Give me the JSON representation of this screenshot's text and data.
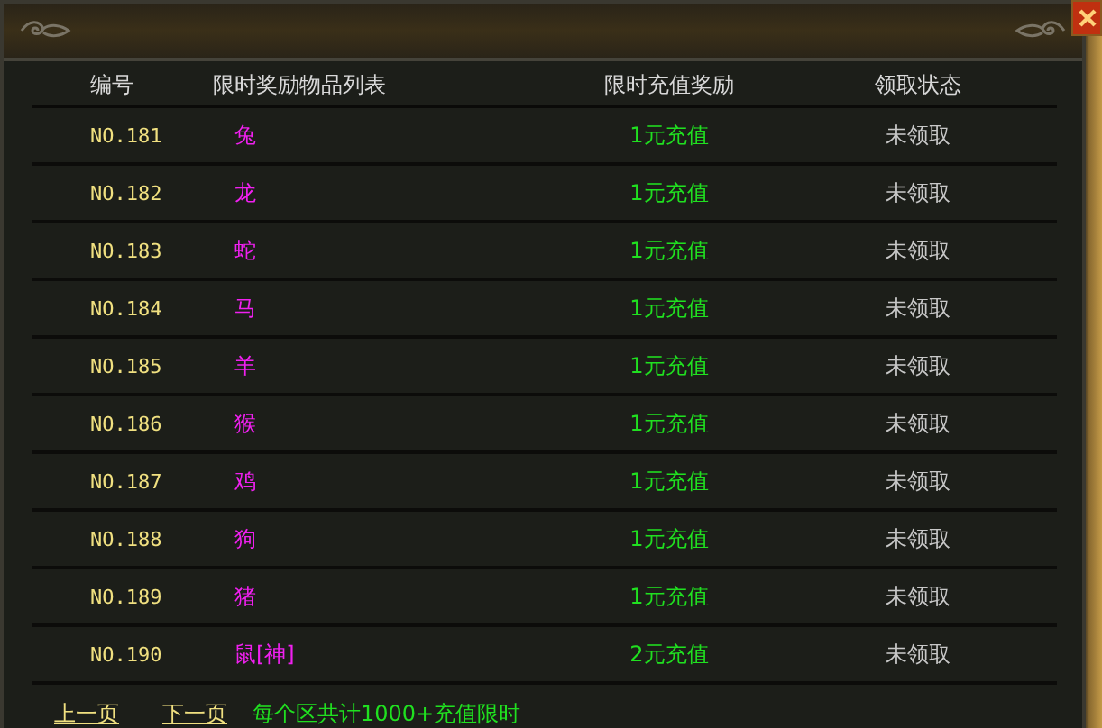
{
  "columns": [
    "编号",
    "限时奖励物品列表",
    "限时充值奖励",
    "领取状态"
  ],
  "rows": [
    {
      "number": "NO.181",
      "item": "兔",
      "reward": "1元充值",
      "status": "未领取"
    },
    {
      "number": "NO.182",
      "item": "龙",
      "reward": "1元充值",
      "status": "未领取"
    },
    {
      "number": "NO.183",
      "item": "蛇",
      "reward": "1元充值",
      "status": "未领取"
    },
    {
      "number": "NO.184",
      "item": "马",
      "reward": "1元充值",
      "status": "未领取"
    },
    {
      "number": "NO.185",
      "item": "羊",
      "reward": "1元充值",
      "status": "未领取"
    },
    {
      "number": "NO.186",
      "item": "猴",
      "reward": "1元充值",
      "status": "未领取"
    },
    {
      "number": "NO.187",
      "item": "鸡",
      "reward": "1元充值",
      "status": "未领取"
    },
    {
      "number": "NO.188",
      "item": "狗",
      "reward": "1元充值",
      "status": "未领取"
    },
    {
      "number": "NO.189",
      "item": "猪",
      "reward": "1元充值",
      "status": "未领取"
    },
    {
      "number": "NO.190",
      "item": "鼠[神]",
      "reward": "2元充值",
      "status": "未领取"
    }
  ],
  "footer": {
    "prev": "上一页",
    "next": "下一页",
    "note": "每个区共计1000+充值限时"
  }
}
